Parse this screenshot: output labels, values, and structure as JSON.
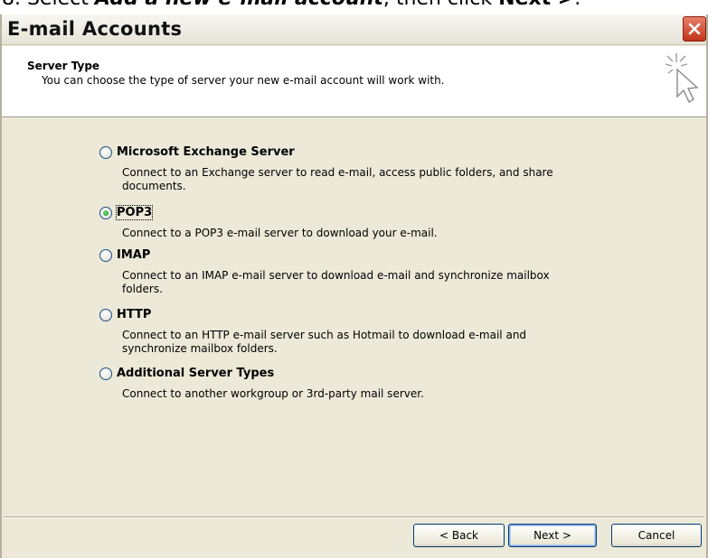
{
  "caption": {
    "prefix": "8.  Select ",
    "emphasis1": "Add a new e-mail account",
    "middle": ", then click ",
    "emphasis2": "Next >",
    "suffix": "."
  },
  "window": {
    "title": "E-mail Accounts"
  },
  "header": {
    "title": "Server Type",
    "subtitle": "You can choose the type of server your new e-mail account will work with."
  },
  "options": [
    {
      "label": "Microsoft Exchange Server",
      "desc1": "Connect to an Exchange server to read e-mail, access public folders, and share",
      "desc2": "documents.",
      "checked": false
    },
    {
      "label": "POP3",
      "desc1": "Connect to a POP3 e-mail server to download your e-mail.",
      "desc2": "",
      "checked": true
    },
    {
      "label": "IMAP",
      "desc1": "Connect to an IMAP e-mail server to download e-mail and synchronize mailbox",
      "desc2": "folders.",
      "checked": false
    },
    {
      "label": "HTTP",
      "desc1": "Connect to an HTTP e-mail server such as Hotmail to download e-mail and",
      "desc2": "synchronize mailbox folders.",
      "checked": false
    },
    {
      "label": "Additional Server Types",
      "desc1": "Connect to another workgroup or 3rd-party mail server.",
      "desc2": "",
      "checked": false
    }
  ],
  "buttons": {
    "back": "< Back",
    "next": "Next >",
    "cancel": "Cancel"
  },
  "icons": {
    "close": "close-icon",
    "wizard": "cursor-sparkle-icon"
  },
  "colors": {
    "dialog_bg": "#ece9d8",
    "close_red": "#c2351a",
    "radio_green": "#1d8a1d"
  }
}
